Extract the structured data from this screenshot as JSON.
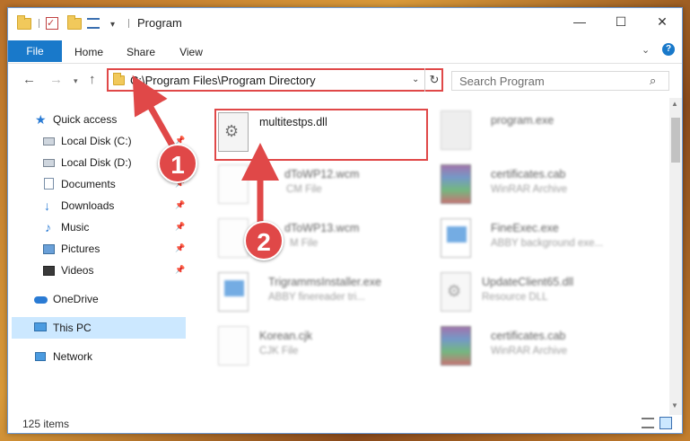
{
  "window": {
    "title": "Program",
    "min_icon": "minimize-icon",
    "max_icon": "maximize-icon",
    "close_icon": "close-icon"
  },
  "ribbon": {
    "tabs": [
      "File",
      "Home",
      "Share",
      "View"
    ],
    "help": "?"
  },
  "address": {
    "path": "C:\\Program Files\\Program Directory",
    "search_placeholder": "Search Program"
  },
  "sidebar": {
    "items": [
      {
        "label": "Quick access",
        "icon": "star-icon",
        "pinned": false
      },
      {
        "label": "Local Disk (C:)",
        "icon": "disk-icon",
        "pinned": true
      },
      {
        "label": "Local Disk (D:)",
        "icon": "disk-icon",
        "pinned": false
      },
      {
        "label": "Documents",
        "icon": "documents-icon",
        "pinned": true
      },
      {
        "label": "Downloads",
        "icon": "downloads-icon",
        "pinned": true
      },
      {
        "label": "Music",
        "icon": "music-icon",
        "pinned": true
      },
      {
        "label": "Pictures",
        "icon": "pictures-icon",
        "pinned": true
      },
      {
        "label": "Videos",
        "icon": "videos-icon",
        "pinned": true
      },
      {
        "label": "OneDrive",
        "icon": "onedrive-icon",
        "pinned": false
      },
      {
        "label": "This PC",
        "icon": "this-pc-icon",
        "pinned": false,
        "selected": true
      },
      {
        "label": "Network",
        "icon": "network-icon",
        "pinned": false
      }
    ]
  },
  "files": [
    {
      "name": "multitestps.dll",
      "type": "",
      "icon": "dll-icon",
      "highlighted": true
    },
    {
      "name": "program.exe",
      "type": "",
      "icon": "program-icon"
    },
    {
      "name": "dToWP12.wcm",
      "type": "CM File",
      "icon": "document-icon"
    },
    {
      "name": "certificates.cab",
      "type": "WinRAR Archive",
      "icon": "rar-icon"
    },
    {
      "name": "dToWP13.wcm",
      "type": "M File",
      "icon": "document-icon"
    },
    {
      "name": "FineExec.exe",
      "type": "ABBY background exe...",
      "icon": "app-icon"
    },
    {
      "name": "TrigrammsInstaller.exe",
      "type": "ABBY finereader tri...",
      "icon": "app-icon"
    },
    {
      "name": "UpdateClient65.dll",
      "type": "Resource DLL",
      "icon": "dll-icon"
    },
    {
      "name": "Korean.cjk",
      "type": "CJK File",
      "icon": "document-icon"
    },
    {
      "name": "certificates.cab",
      "type": "WinRAR Archive",
      "icon": "rar-icon"
    }
  ],
  "status": {
    "item_count": "125 items"
  },
  "annotations": {
    "badge_1": "1",
    "badge_2": "2",
    "color": "#e04848"
  }
}
